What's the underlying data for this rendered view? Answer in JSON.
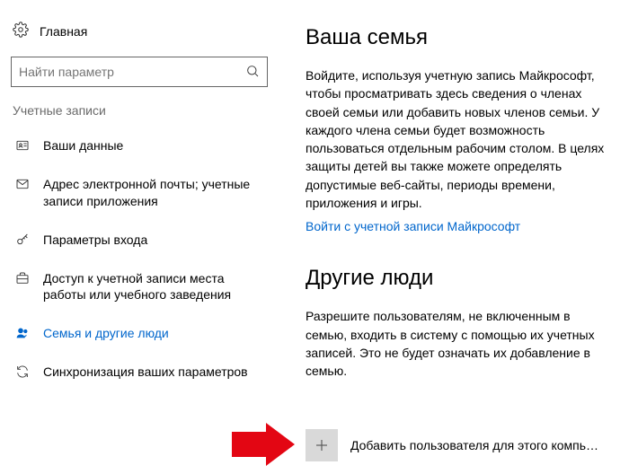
{
  "sidebar": {
    "home_label": "Главная",
    "search_placeholder": "Найти параметр",
    "section_label": "Учетные записи",
    "items": [
      {
        "label": "Ваши данные"
      },
      {
        "label": "Адрес электронной почты; учетные записи приложения"
      },
      {
        "label": "Параметры входа"
      },
      {
        "label": "Доступ к учетной записи места работы или учебного заведения"
      },
      {
        "label": "Семья и другие люди"
      },
      {
        "label": "Синхронизация ваших параметров"
      }
    ]
  },
  "main": {
    "family_title": "Ваша семья",
    "family_body": "Войдите, используя учетную запись Майкрософт, чтобы просматривать здесь сведения о членах своей семьи или добавить новых членов семьи. У каждого члена семьи будет возможность пользоваться отдельным рабочим столом. В целях защиты детей вы также можете определять допустимые веб-сайты, периоды времени, приложения и игры.",
    "family_signin_link": "Войти с учетной записи Майкрософт",
    "others_title": "Другие люди",
    "others_body": "Разрешите пользователям, не включенным в семью, входить в систему с помощью их учетных записей. Это не будет означать их добавление в семью.",
    "add_user_label": "Добавить пользователя для этого компь…"
  }
}
